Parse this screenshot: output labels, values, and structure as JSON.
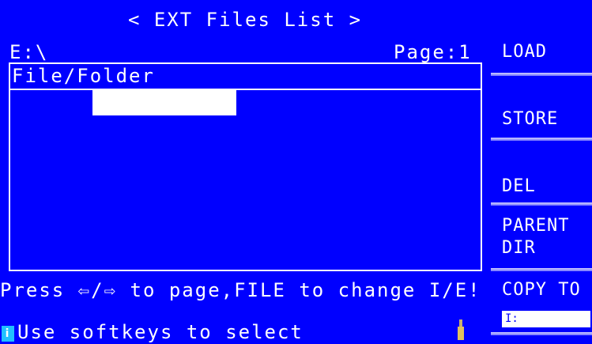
{
  "window": {
    "title": "< EXT Files List >"
  },
  "path": {
    "drive": "E:\\",
    "page": "Page:1"
  },
  "file_list": {
    "header": "File/Folder",
    "items": []
  },
  "hint": "Press ⇦/⇨ to page,FILE to change I/E!",
  "status": {
    "icon": "info-icon",
    "text": "Use softkeys to select"
  },
  "softkeys": {
    "load": "LOAD",
    "store": "STORE",
    "del": "DEL",
    "parent_line1": "PARENT",
    "parent_line2": "DIR",
    "copy_to": "COPY TO",
    "copy_target_value": "I:"
  },
  "colors": {
    "background": "#0000ff",
    "foreground": "#ffffff",
    "info_icon": "#20c0ff"
  }
}
